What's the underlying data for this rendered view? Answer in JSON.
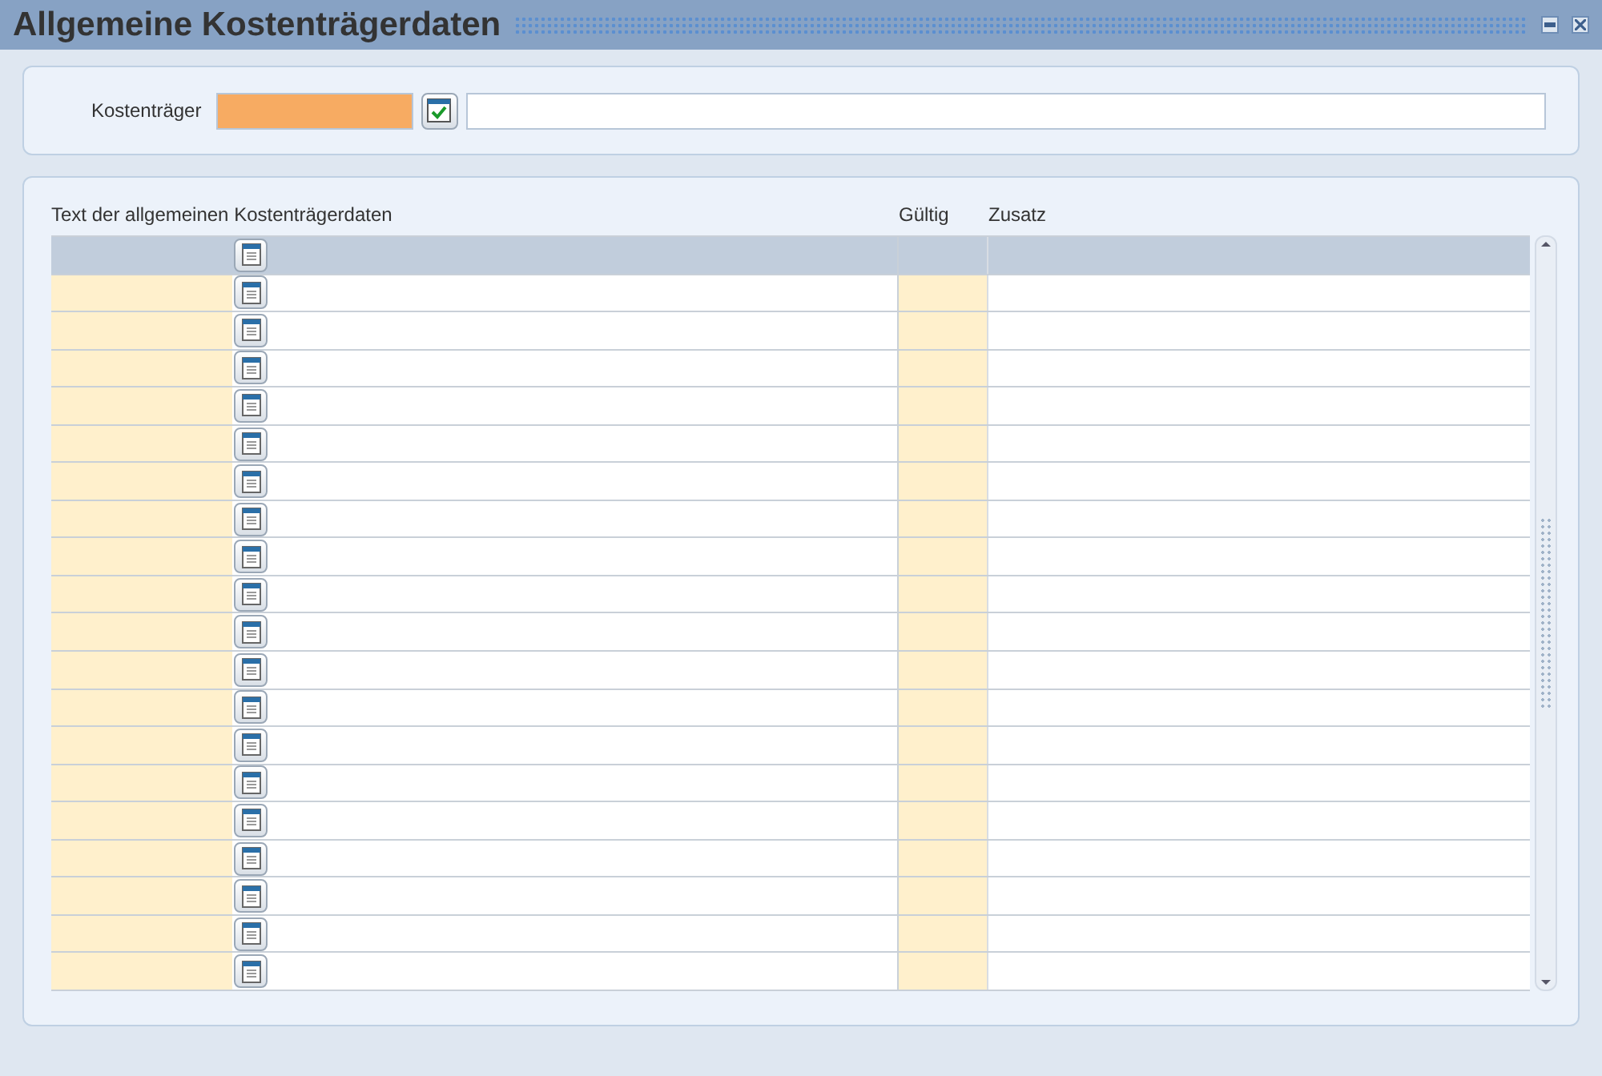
{
  "window": {
    "title": "Allgemeine Kostenträgerdaten"
  },
  "header": {
    "label": "Kostenträger"
  },
  "table": {
    "columns": [
      "Text der allgemeinen Kostenträgerdaten",
      "Gültig",
      "Zusatz"
    ],
    "rows": [
      {
        "selected": true
      },
      {
        "selected": false
      },
      {
        "selected": false
      },
      {
        "selected": false
      },
      {
        "selected": false
      },
      {
        "selected": false
      },
      {
        "selected": false
      },
      {
        "selected": false
      },
      {
        "selected": false
      },
      {
        "selected": false
      },
      {
        "selected": false
      },
      {
        "selected": false
      },
      {
        "selected": false
      },
      {
        "selected": false
      },
      {
        "selected": false
      },
      {
        "selected": false
      },
      {
        "selected": false
      },
      {
        "selected": false
      },
      {
        "selected": false
      },
      {
        "selected": false
      }
    ]
  }
}
